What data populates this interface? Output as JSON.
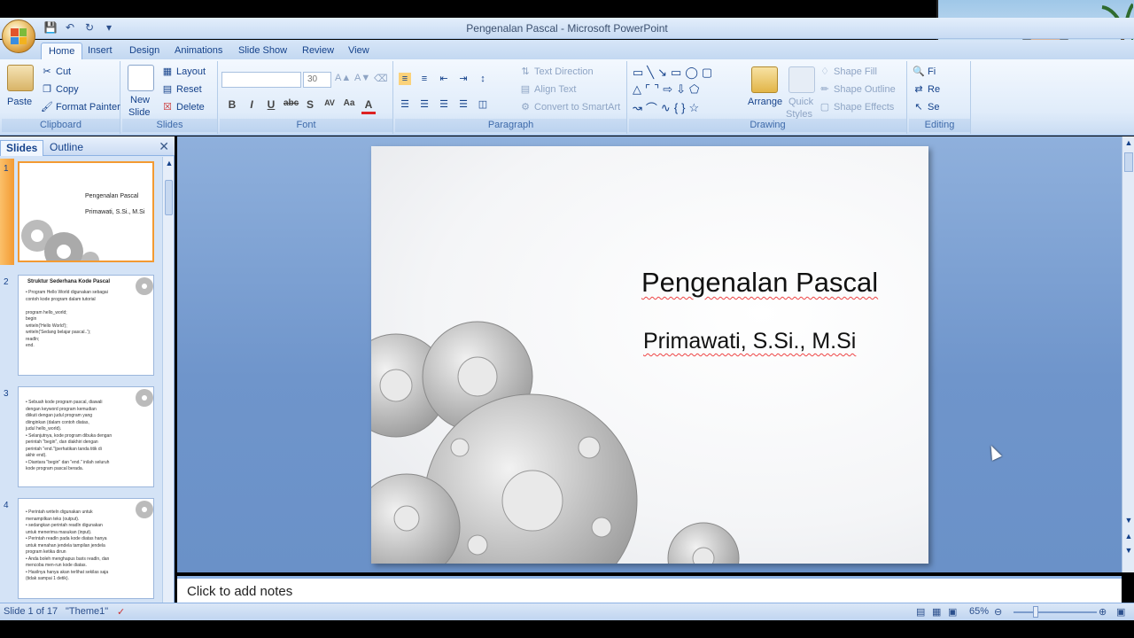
{
  "app": {
    "title": "Pengenalan Pascal - Microsoft PowerPoint"
  },
  "tabs": [
    "Home",
    "Insert",
    "Design",
    "Animations",
    "Slide Show",
    "Review",
    "View"
  ],
  "ribbon": {
    "clipboard": {
      "label": "Clipboard",
      "paste": "Paste",
      "cut": "Cut",
      "copy": "Copy",
      "format_painter": "Format Painter"
    },
    "slides": {
      "label": "Slides",
      "new_slide": "New",
      "new_slide_2": "Slide",
      "layout": "Layout",
      "reset": "Reset",
      "delete": "Delete"
    },
    "font": {
      "label": "Font",
      "font_size": "30"
    },
    "paragraph": {
      "label": "Paragraph",
      "text_direction": "Text Direction",
      "align_text": "Align Text",
      "convert_smartart": "Convert to SmartArt"
    },
    "drawing": {
      "label": "Drawing",
      "arrange": "Arrange",
      "quick_styles": "Quick",
      "quick_styles_2": "Styles",
      "shape_fill": "Shape Fill",
      "shape_outline": "Shape Outline",
      "shape_effects": "Shape Effects"
    },
    "editing": {
      "label": "Editing",
      "find": "Fi",
      "replace": "Re",
      "select": "Se"
    }
  },
  "panel": {
    "tab_slides": "Slides",
    "tab_outline": "Outline"
  },
  "thumbnails": [
    {
      "num": "1",
      "title": "Pengenalan Pascal",
      "subtitle": "Primawati, S.Si., M.Si"
    },
    {
      "num": "2",
      "title": "Struktur Sederhana Kode Pascal",
      "lines": [
        "• Program Hello World digunakan sebagai",
        "  contoh kode program dalam tutorial",
        "",
        "  program hello_world;",
        "  begin",
        "    writeln('Hello World');",
        "    writeln('Sedang belajar pascal..');",
        "    readln;",
        "  end."
      ]
    },
    {
      "num": "3",
      "lines": [
        "• Sebuah kode program pascal, diawali",
        "  dengan keyword program kemudian",
        "  diikuti dengan judul program yang",
        "  diinginkan (dalam contoh diatas,",
        "  judul hello_world).",
        "• Selanjutnya, kode program dibuka dengan",
        "  perintah \"begin\", dan diakhiri dengan",
        "  perintah \"end.\"(perhatikan tanda titik di",
        "  akhir end).",
        "• Diantara \"begin\" dan \"end.\" inilah seluruh",
        "  kode program pascal berada."
      ]
    },
    {
      "num": "4",
      "lines": [
        "• Perintah writeln digunakan untuk",
        "  menampilkan teks (output).",
        "• sedangkan perintah readln digunakan",
        "  untuk menerima masukan (input).",
        "• Perintah readln pada kode diatas hanya",
        "  untuk menahan jendela tampilan jendela",
        "  program ketika dirun",
        "• Anda boleh menghapus baris readln, dan",
        "  mencoba men-run kode diatas.",
        "• Hasilnya hanya akan terlihat sekilas saja",
        "  (tidak sampai 1 detik)."
      ]
    }
  ],
  "slide": {
    "title": "Pengenalan Pascal",
    "subtitle": "Primawati, S.Si., M.Si"
  },
  "notes": {
    "placeholder": "Click to add notes"
  },
  "status": {
    "slide_info": "Slide 1 of 17",
    "theme": "\"Theme1\"",
    "zoom": "65%"
  }
}
